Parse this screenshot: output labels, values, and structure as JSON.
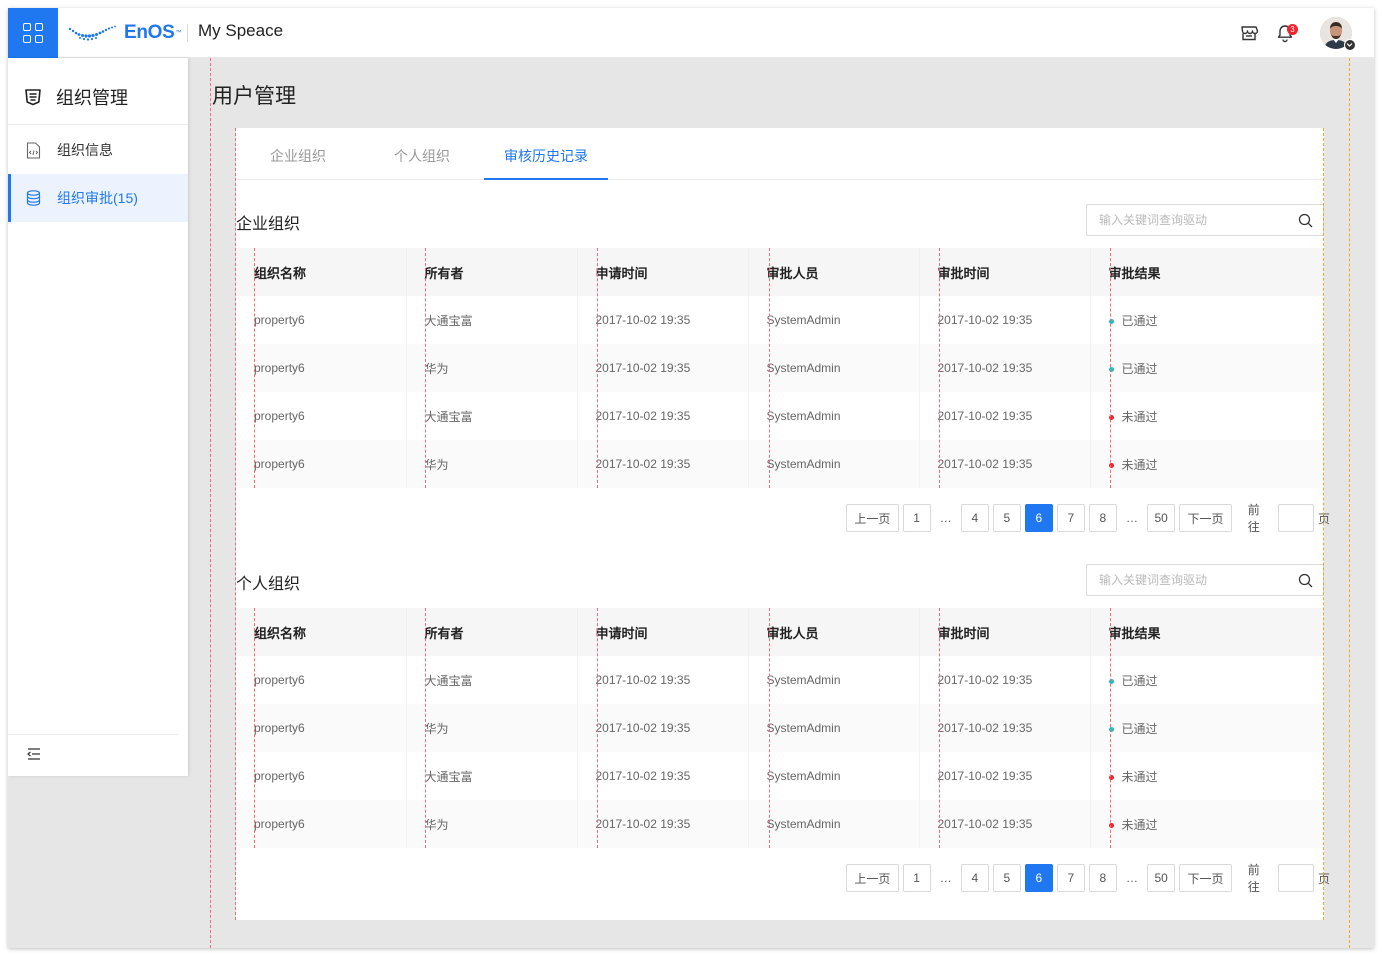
{
  "header": {
    "logo_text": "EnOS",
    "logo_tm": "™",
    "app_title": "My Speace",
    "notification_count": "3"
  },
  "sidebar": {
    "title": "组织管理",
    "items": [
      {
        "label": "组织信息",
        "icon": "document-code-icon"
      },
      {
        "label": "组织审批(15)",
        "icon": "database-icon",
        "active": true
      }
    ]
  },
  "page": {
    "title": "用户管理"
  },
  "tabs": [
    {
      "label": "企业组织"
    },
    {
      "label": "个人组织"
    },
    {
      "label": "审核历史记录",
      "active": true
    }
  ],
  "sections": [
    {
      "title": "企业组织",
      "search_placeholder": "输入关键词查询驱动",
      "columns": [
        "组织名称",
        "所有者",
        "申请时间",
        "审批人员",
        "审批时间",
        "审批结果"
      ],
      "rows": [
        [
          "property6",
          "大通宝富",
          "2017-10-02 19:35",
          "SystemAdmin",
          "2017-10-02 19:35",
          "已通过"
        ],
        [
          "property6",
          "华为",
          "2017-10-02 19:35",
          "SystemAdmin",
          "2017-10-02 19:35",
          "已通过"
        ],
        [
          "property6",
          "大通宝富",
          "2017-10-02 19:35",
          "SystemAdmin",
          "2017-10-02 19:35",
          "未通过"
        ],
        [
          "property6",
          "华为",
          "2017-10-02 19:35",
          "SystemAdmin",
          "2017-10-02 19:35",
          "未通过"
        ]
      ]
    },
    {
      "title": "个人组织",
      "search_placeholder": "输入关键词查询驱动",
      "columns": [
        "组织名称",
        "所有者",
        "申请时间",
        "审批人员",
        "审批时间",
        "审批结果"
      ],
      "rows": [
        [
          "property6",
          "大通宝富",
          "2017-10-02 19:35",
          "SystemAdmin",
          "2017-10-02 19:35",
          "已通过"
        ],
        [
          "property6",
          "华为",
          "2017-10-02 19:35",
          "SystemAdmin",
          "2017-10-02 19:35",
          "已通过"
        ],
        [
          "property6",
          "大通宝富",
          "2017-10-02 19:35",
          "SystemAdmin",
          "2017-10-02 19:35",
          "未通过"
        ],
        [
          "property6",
          "华为",
          "2017-10-02 19:35",
          "SystemAdmin",
          "2017-10-02 19:35",
          "未通过"
        ]
      ]
    }
  ],
  "pagination": {
    "prev": "上一页",
    "next": "下一页",
    "pages": [
      "1",
      "…",
      "4",
      "5",
      "6",
      "7",
      "8",
      "…",
      "50"
    ],
    "current": "6",
    "goto_label": "前往",
    "goto_suffix": "页"
  },
  "colors": {
    "accent": "#1f78f0",
    "pass": "#13c2c2",
    "fail": "#f5222d"
  }
}
